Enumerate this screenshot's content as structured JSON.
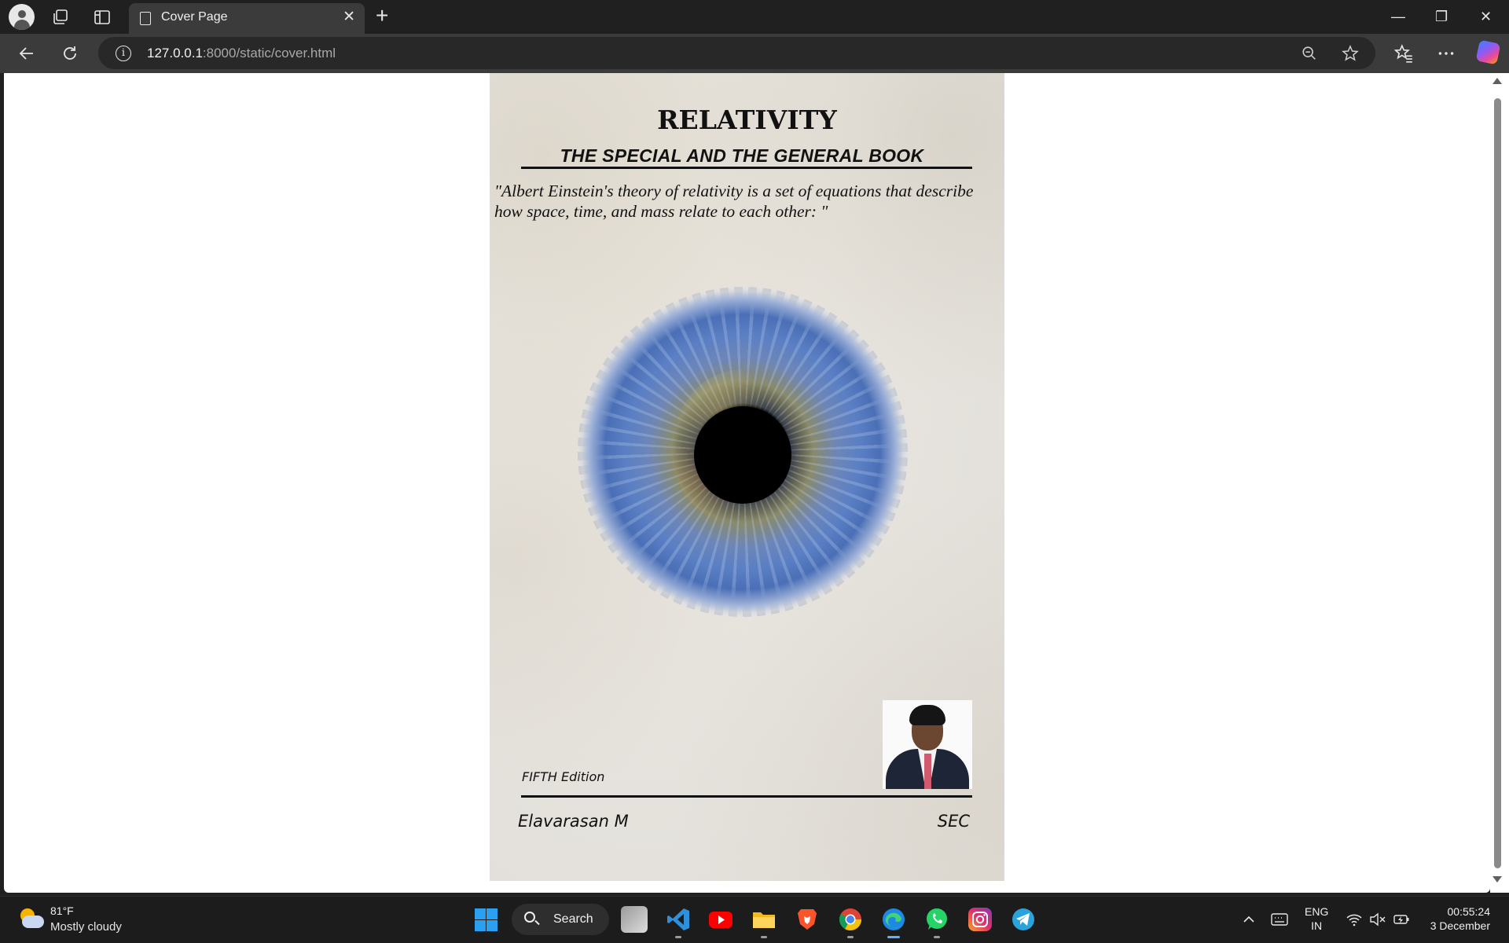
{
  "browser": {
    "tab_title": "Cover Page",
    "tab_close": "✕",
    "new_tab": "+",
    "url_host": "127.0.0.1",
    "url_path": ":8000/static/cover.html",
    "window_controls": {
      "minimize": "—",
      "restore": "❐",
      "close": "✕"
    },
    "icons": {
      "back": "back-arrow-icon",
      "refresh": "refresh-icon",
      "info": "site-info-icon",
      "zoom": "zoom-out-icon",
      "favorite": "star-icon",
      "favorites": "favorites-icon",
      "more": "more-icon",
      "copilot": "copilot-icon"
    }
  },
  "cover": {
    "title": "RELATIVITY",
    "subtitle": "THE SPECIAL AND THE GENERAL BOOK",
    "quote": "\"Albert Einstein's theory of relativity is a set of equations that describe how space, time, and mass relate to each other: \"",
    "edition": "FIFTH Edition",
    "author": "Elavarasan M",
    "college": "SEC"
  },
  "taskbar": {
    "temperature": "81°F",
    "condition": "Mostly cloudy",
    "search_label": "Search",
    "language_top": "ENG",
    "language_bottom": "IN",
    "time": "00:55:24",
    "date": "3 December",
    "apps": [
      "task-view",
      "vscode",
      "youtube",
      "file-explorer",
      "brave",
      "chrome",
      "edge",
      "whatsapp",
      "instagram",
      "telegram"
    ]
  },
  "colors": {
    "browser_bg": "#202020",
    "toolbar_bg": "#3b3b3b",
    "cover_bg": "#e6e3dd",
    "iris_blue": "#5a7fc4"
  }
}
